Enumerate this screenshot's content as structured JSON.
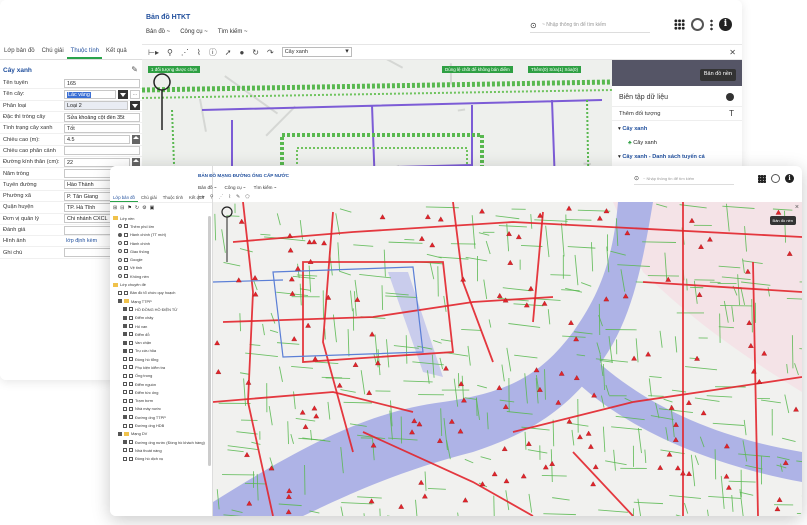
{
  "back": {
    "title": "Bản đồ HTKT",
    "menu": [
      "Bản đồ ~",
      "Công cụ ~",
      "Tìm kiếm ~"
    ],
    "search_placeholder": "~  Nhập thông tin để tìm kiếm",
    "toolbar_select": "Cây xanh",
    "tabs": [
      "Lớp bản đồ",
      "Chú giải",
      "Thuộc tính",
      "Kết quả"
    ],
    "active_tab": "Thuộc tính",
    "section_title": "Cây xanh",
    "attributes": [
      {
        "label": "Tên tuyến",
        "value": "165"
      },
      {
        "label": "Tên cây:",
        "value": "Lác vàng"
      },
      {
        "label": "Phân loại",
        "value": "Loại 2"
      },
      {
        "label": "Đặc thì trồng cây",
        "value": "Sửa khoảng cột đèn 35t"
      },
      {
        "label": "Tình trạng cây xanh",
        "value": "Tốt"
      },
      {
        "label": "Chiều cao (m):",
        "value": "4.5"
      },
      {
        "label": "Chiều cao phân cảnh",
        "value": ""
      },
      {
        "label": "Đường kính thân (cm):",
        "value": "22"
      },
      {
        "label": "Năm trồng",
        "value": ""
      },
      {
        "label": "Tuyến đường",
        "value": "Hào Thành"
      },
      {
        "label": "Phường xã",
        "value": "P. Tân Giang"
      },
      {
        "label": "Quận huyện",
        "value": "TP. Hà Tĩnh"
      },
      {
        "label": "Đơn vị quản lý",
        "value": "Chi nhánh CXCL"
      },
      {
        "label": "Đánh giá",
        "value": ""
      },
      {
        "label": "Hình ảnh",
        "value": "lớp định kèm"
      },
      {
        "label": "Ghi chú",
        "value": ""
      }
    ],
    "map_labels": {
      "selected": "1 đối tượng được chọn",
      "hint": "Dùng lệ chốt để không bán điểm",
      "counts": "Thêm(0)  Sửa(1)  Xóa(0)"
    },
    "basemap_btn": "Bản đồ nền",
    "edit_panel_title": "Biên tập dữ liệu",
    "add_object": "Thêm đối tượng",
    "tree_items": [
      "Cây xanh",
      "Cây xanh",
      "Cây xanh - Danh sách tuyến cá"
    ]
  },
  "front": {
    "title": "BẢN ĐỒ MẠNG ĐƯỜNG ỐNG CẤP NƯỚC",
    "menu": [
      "Bản đồ ~",
      "Công cụ ~",
      "Tìm kiếm ~"
    ],
    "search_placeholder": "~  Nhập thông tin để tìm kiếm",
    "tabs": [
      "Lớp bản đồ",
      "Chú giải",
      "Thuộc tính",
      "Kết quả"
    ],
    "active_tab": "Lớp bản đồ",
    "basemap_btn": "Bản đồ nền",
    "tree": [
      {
        "label": "Lớp nền",
        "kind": "folder",
        "level": 0
      },
      {
        "label": "Thêm phố lớn",
        "kind": "radio",
        "level": 1
      },
      {
        "label": "Hành chính (TT mới)",
        "kind": "radio-on",
        "level": 1
      },
      {
        "label": "Hành chính",
        "kind": "radio",
        "level": 1
      },
      {
        "label": "Giao thông",
        "kind": "radio",
        "level": 1
      },
      {
        "label": "Google",
        "kind": "radio",
        "level": 1
      },
      {
        "label": "Vệ tinh",
        "kind": "radio",
        "level": 1
      },
      {
        "label": "Không nền",
        "kind": "radio",
        "level": 1
      },
      {
        "label": "Lớp chuyên đề",
        "kind": "folder",
        "level": 0
      },
      {
        "label": "Bản đồ tổ chức quy hoạch",
        "kind": "check",
        "level": 1
      },
      {
        "label": "Mạng TTPP",
        "kind": "folder-check",
        "level": 1
      },
      {
        "label": "HỒ ĐỒNG HỒ ĐIỆN TỬ",
        "kind": "check-on",
        "level": 2
      },
      {
        "label": "Điểm chảy",
        "kind": "check-on",
        "level": 2
      },
      {
        "label": "Hố van",
        "kind": "check-on",
        "level": 2
      },
      {
        "label": "Điểm đỗ",
        "kind": "check-on",
        "level": 2
      },
      {
        "label": "Van chặn",
        "kind": "check-on",
        "level": 2
      },
      {
        "label": "Trụ cứu hỏa",
        "kind": "check-on",
        "level": 2
      },
      {
        "label": "Đồng hồ tổng",
        "kind": "check",
        "level": 2
      },
      {
        "label": "Phụ kiện kiểm tra",
        "kind": "check",
        "level": 2
      },
      {
        "label": "Ống trong",
        "kind": "check",
        "level": 2
      },
      {
        "label": "Điểm nguồn",
        "kind": "check",
        "level": 2
      },
      {
        "label": "Điểm tức ống",
        "kind": "check",
        "level": 2
      },
      {
        "label": "Trạm bơm",
        "kind": "check",
        "level": 2
      },
      {
        "label": "Nhà máy nước",
        "kind": "check",
        "level": 2
      },
      {
        "label": "Đường ống TTPP",
        "kind": "check-on",
        "level": 2
      },
      {
        "label": "Đường ống HDB",
        "kind": "check",
        "level": 2
      },
      {
        "label": "Mạng DV",
        "kind": "folder-check",
        "level": 1
      },
      {
        "label": "Đường ống nước (Đồng hồ khách hàng)",
        "kind": "check-on",
        "level": 2
      },
      {
        "label": "Nhà thoát nàng",
        "kind": "check",
        "level": 2
      },
      {
        "label": "Đồng hồ dịch vụ",
        "kind": "check",
        "level": 2
      }
    ]
  },
  "colors": {
    "pipe_red": "#e2242b",
    "pipe_green": "#58b84f",
    "pipe_purple": "#7c5cd6",
    "river": "#aeb3e6",
    "accent_blue": "#1f4e9c"
  }
}
